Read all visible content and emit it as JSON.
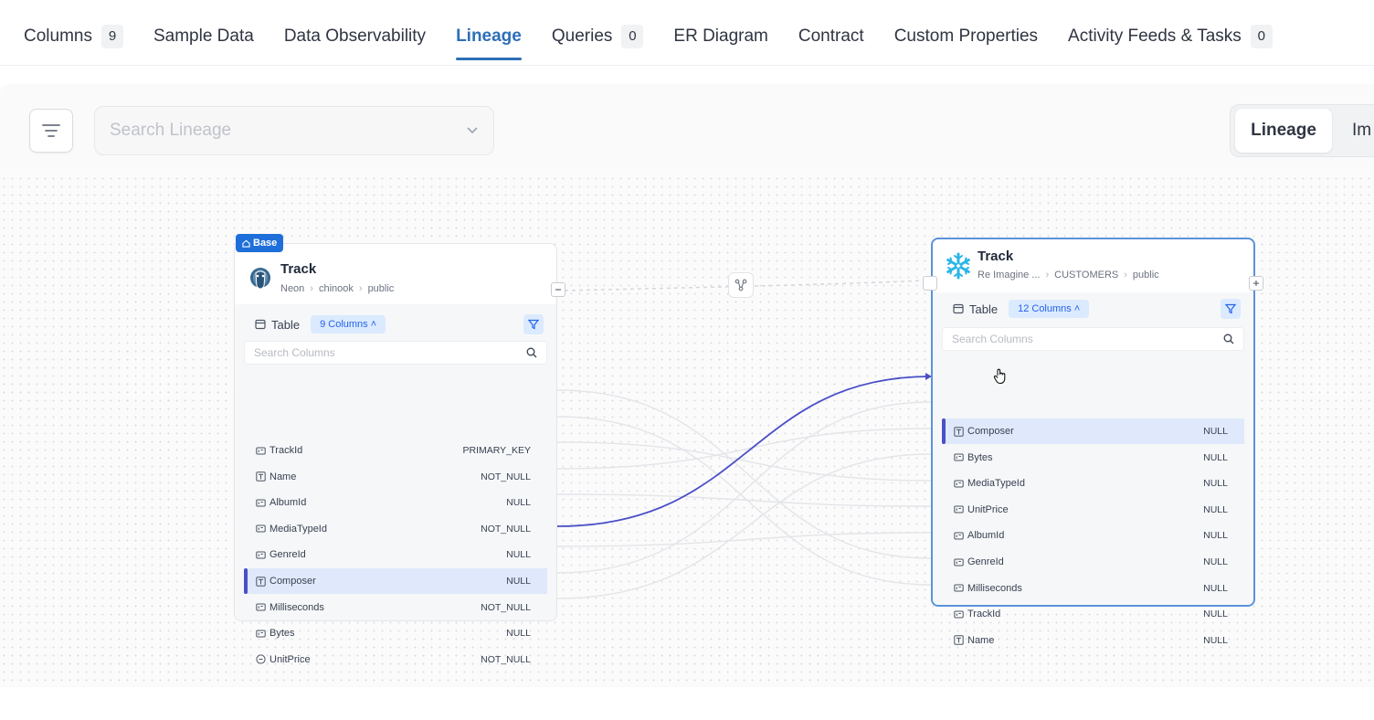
{
  "tabs": [
    {
      "label": "Columns",
      "count": "9"
    },
    {
      "label": "Sample Data"
    },
    {
      "label": "Data Observability"
    },
    {
      "label": "Lineage",
      "active": true
    },
    {
      "label": "Queries",
      "count": "0"
    },
    {
      "label": "ER Diagram"
    },
    {
      "label": "Contract"
    },
    {
      "label": "Custom Properties"
    },
    {
      "label": "Activity Feeds & Tasks",
      "count": "0"
    }
  ],
  "toolbar": {
    "search_placeholder": "Search Lineage",
    "view_active": "Lineage",
    "view_other": "Im"
  },
  "left_node": {
    "badge": "Base",
    "title": "Track",
    "crumbs": [
      "Neon",
      "chinook",
      "public"
    ],
    "type_label": "Table",
    "columns_pill": "9 Columns",
    "search_placeholder": "Search Columns",
    "columns": [
      {
        "name": "TrackId",
        "constraint": "PRIMARY_KEY",
        "icon": "number-icon"
      },
      {
        "name": "Name",
        "constraint": "NOT_NULL",
        "icon": "text-icon"
      },
      {
        "name": "AlbumId",
        "constraint": "NULL",
        "icon": "number-icon"
      },
      {
        "name": "MediaTypeId",
        "constraint": "NOT_NULL",
        "icon": "number-icon"
      },
      {
        "name": "GenreId",
        "constraint": "NULL",
        "icon": "number-icon"
      },
      {
        "name": "Composer",
        "constraint": "NULL",
        "icon": "text-icon",
        "highlight": true
      },
      {
        "name": "Milliseconds",
        "constraint": "NOT_NULL",
        "icon": "number-icon"
      },
      {
        "name": "Bytes",
        "constraint": "NULL",
        "icon": "number-icon"
      },
      {
        "name": "UnitPrice",
        "constraint": "NOT_NULL",
        "icon": "decimal-icon"
      }
    ]
  },
  "right_node": {
    "title": "Track",
    "crumbs": [
      "Re Imagine ...",
      "CUSTOMERS",
      "public"
    ],
    "type_label": "Table",
    "columns_pill": "12 Columns",
    "search_placeholder": "Search Columns",
    "columns": [
      {
        "name": "Composer",
        "constraint": "NULL",
        "icon": "text-icon",
        "highlight": true
      },
      {
        "name": "Bytes",
        "constraint": "NULL",
        "icon": "number-icon"
      },
      {
        "name": "MediaTypeId",
        "constraint": "NULL",
        "icon": "number-icon"
      },
      {
        "name": "UnitPrice",
        "constraint": "NULL",
        "icon": "number-icon"
      },
      {
        "name": "AlbumId",
        "constraint": "NULL",
        "icon": "number-icon"
      },
      {
        "name": "GenreId",
        "constraint": "NULL",
        "icon": "number-icon"
      },
      {
        "name": "Milliseconds",
        "constraint": "NULL",
        "icon": "number-icon"
      },
      {
        "name": "TrackId",
        "constraint": "NULL",
        "icon": "number-icon"
      },
      {
        "name": "Name",
        "constraint": "NULL",
        "icon": "text-icon"
      }
    ]
  },
  "colors": {
    "accent": "#2d6fb7",
    "highlight_edge": "#4a4fc7",
    "badge": "#1e6fd9"
  }
}
